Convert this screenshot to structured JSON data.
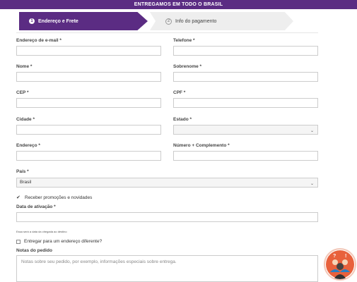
{
  "banner": {
    "text": "ENTREGAMOS EM TODO O BRASIL"
  },
  "steps": [
    {
      "num": "1",
      "label": "Endereço e Frete"
    },
    {
      "num": "2",
      "label": "Info do pagamento"
    }
  ],
  "form": {
    "email_label": "Endereço de e-mail *",
    "phone_label": "Telefone *",
    "name_label": "Nome *",
    "surname_label": "Sobrenome *",
    "cep_label": "CEP *",
    "cpf_label": "CPF *",
    "city_label": "Cidade *",
    "state_label": "Estado *",
    "state_value": "",
    "address_label": "Endereço *",
    "number_label": "Número + Complemento *",
    "country_label": "País *",
    "country_value": "Brasil",
    "promo_label": "Receber promoções e novidades",
    "promo_checked": true,
    "activation_label": "Data de ativação *",
    "activation_hint": "Essa será a data da chegada ao destino",
    "ship_diff_label": "Entregar para um endereço diferente?",
    "notes_label": "Notas do pedido",
    "notes_placeholder": "Notas sobre seu pedido, por exemplo, informações especiais sobre entrega."
  },
  "icons": {
    "check": "check-icon",
    "chevron": "chevron-down-icon",
    "support": "support-badge-icon"
  },
  "colors": {
    "primary": "#5b2c83",
    "badge_bg": "#e8613c"
  }
}
